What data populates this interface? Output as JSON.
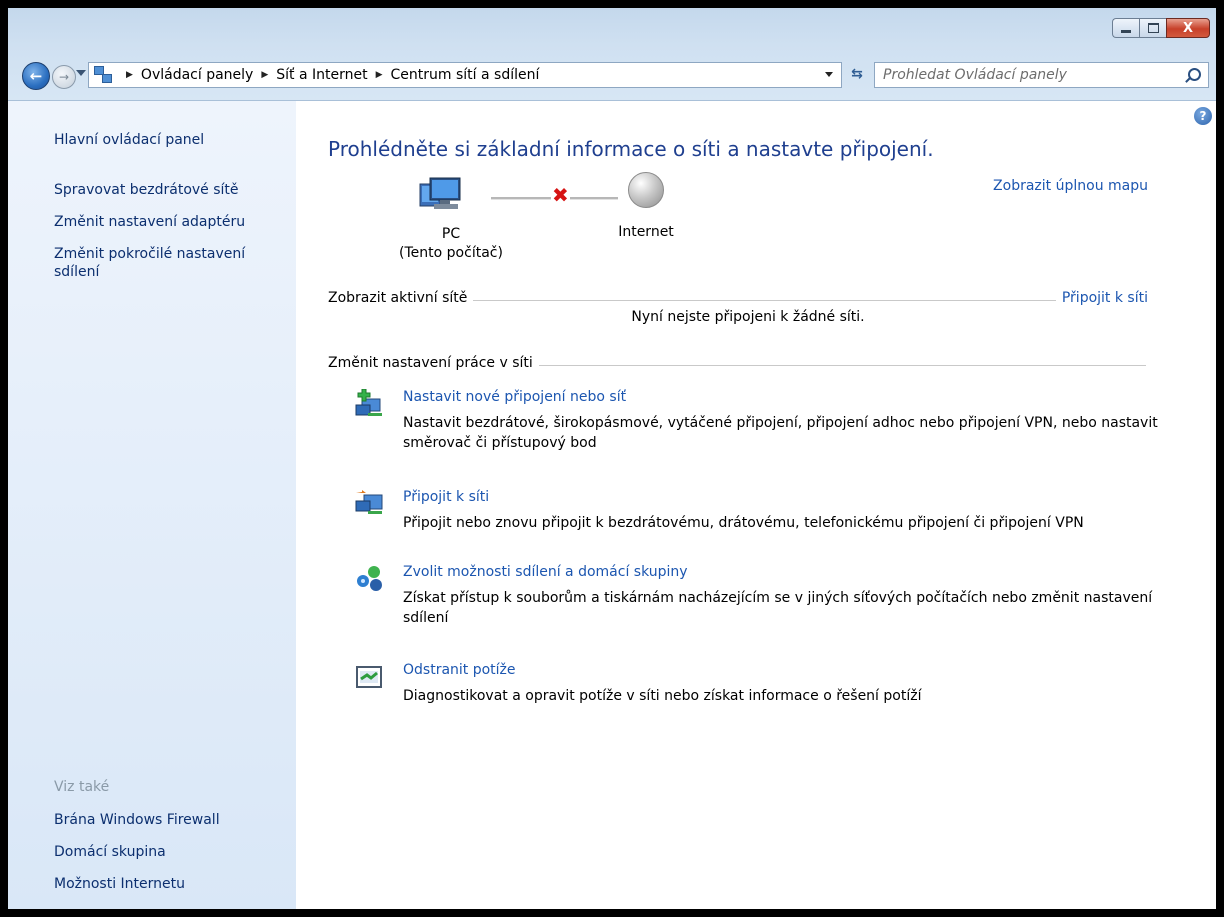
{
  "window": {
    "caption_buttons": {
      "minimize": "minimize",
      "maximize": "maximize",
      "close": "X"
    }
  },
  "nav": {
    "back_glyph": "←",
    "forward_glyph": "→",
    "breadcrumbs": [
      "Ovládací panely",
      "Síť a Internet",
      "Centrum sítí a sdílení"
    ],
    "separator": "▶",
    "refresh_glyph": "⇆",
    "search_placeholder": "Prohledat Ovládací panely"
  },
  "sidebar": {
    "home": "Hlavní ovládací panel",
    "links": [
      "Spravovat bezdrátové sítě",
      "Změnit nastavení adaptéru",
      "Změnit pokročilé nastavení",
      "sdílení"
    ],
    "see_also": "Viz také",
    "see_also_links": [
      "Brána Windows Firewall",
      "Domácí skupina",
      "Možnosti Internetu"
    ]
  },
  "main": {
    "help_glyph": "?",
    "title": "Prohlédněte si základní informace o síti a nastavte připojení.",
    "full_map_link": "Zobrazit úplnou mapu",
    "map": {
      "pc_name": "PC",
      "pc_sub": "(Tento počítač)",
      "disconnected_glyph": "✖",
      "internet": "Internet"
    },
    "active_networks": {
      "heading": "Zobrazit aktivní sítě",
      "connect_link": "Připojit k síti",
      "status": "Nyní nejste připojeni k žádné síti."
    },
    "change_settings": {
      "heading": "Změnit nastavení práce v síti",
      "tasks": [
        {
          "title": "Nastavit nové připojení nebo síť",
          "desc": "Nastavit bezdrátové, širokopásmové, vytáčené připojení, připojení adhoc nebo připojení VPN, nebo nastavit směrovač či přístupový bod",
          "icon": "new-connection-icon"
        },
        {
          "title": "Připojit k síti",
          "desc": "Připojit nebo znovu připojit k bezdrátovému, drátovému, telefonickému připojení či připojení VPN",
          "icon": "connect-network-icon"
        },
        {
          "title": "Zvolit možnosti sdílení a domácí skupiny",
          "desc": "Získat přístup k souborům a tiskárnám nacházejícím se v jiných síťových počítačích nebo změnit nastavení sdílení",
          "icon": "homegroup-icon"
        },
        {
          "title": "Odstranit potíže",
          "desc": "Diagnostikovat a opravit potíže v síti nebo získat informace o řešení potíží",
          "icon": "troubleshoot-icon"
        }
      ]
    }
  }
}
